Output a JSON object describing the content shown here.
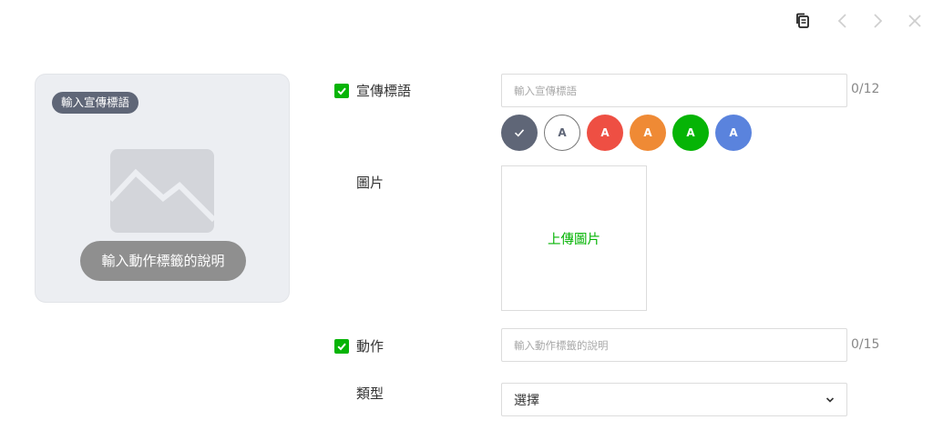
{
  "toolbar": {
    "icons": [
      "copy-icon",
      "chevron-left-icon",
      "chevron-right-icon",
      "close-icon"
    ]
  },
  "preview": {
    "tag": "輸入宣傳標語",
    "action": "輸入動作標籤的說明"
  },
  "form": {
    "slogan": {
      "label": "宣傳標語",
      "checked": true,
      "placeholder": "輸入宣傳標語",
      "count": "0",
      "max": "/12"
    },
    "colors": {
      "letter": "A",
      "options": [
        "#5f6677",
        "#ffffff",
        "#ee4f43",
        "#ef8a35",
        "#06b406",
        "#5a83dd"
      ],
      "selected": 0
    },
    "image": {
      "label": "圖片",
      "upload": "上傳圖片"
    },
    "action": {
      "label": "動作",
      "checked": true,
      "placeholder": "輸入動作標籤的說明",
      "count": "0",
      "max": "/15"
    },
    "type": {
      "label": "類型",
      "value": "選擇"
    }
  },
  "accent": "#06b406"
}
